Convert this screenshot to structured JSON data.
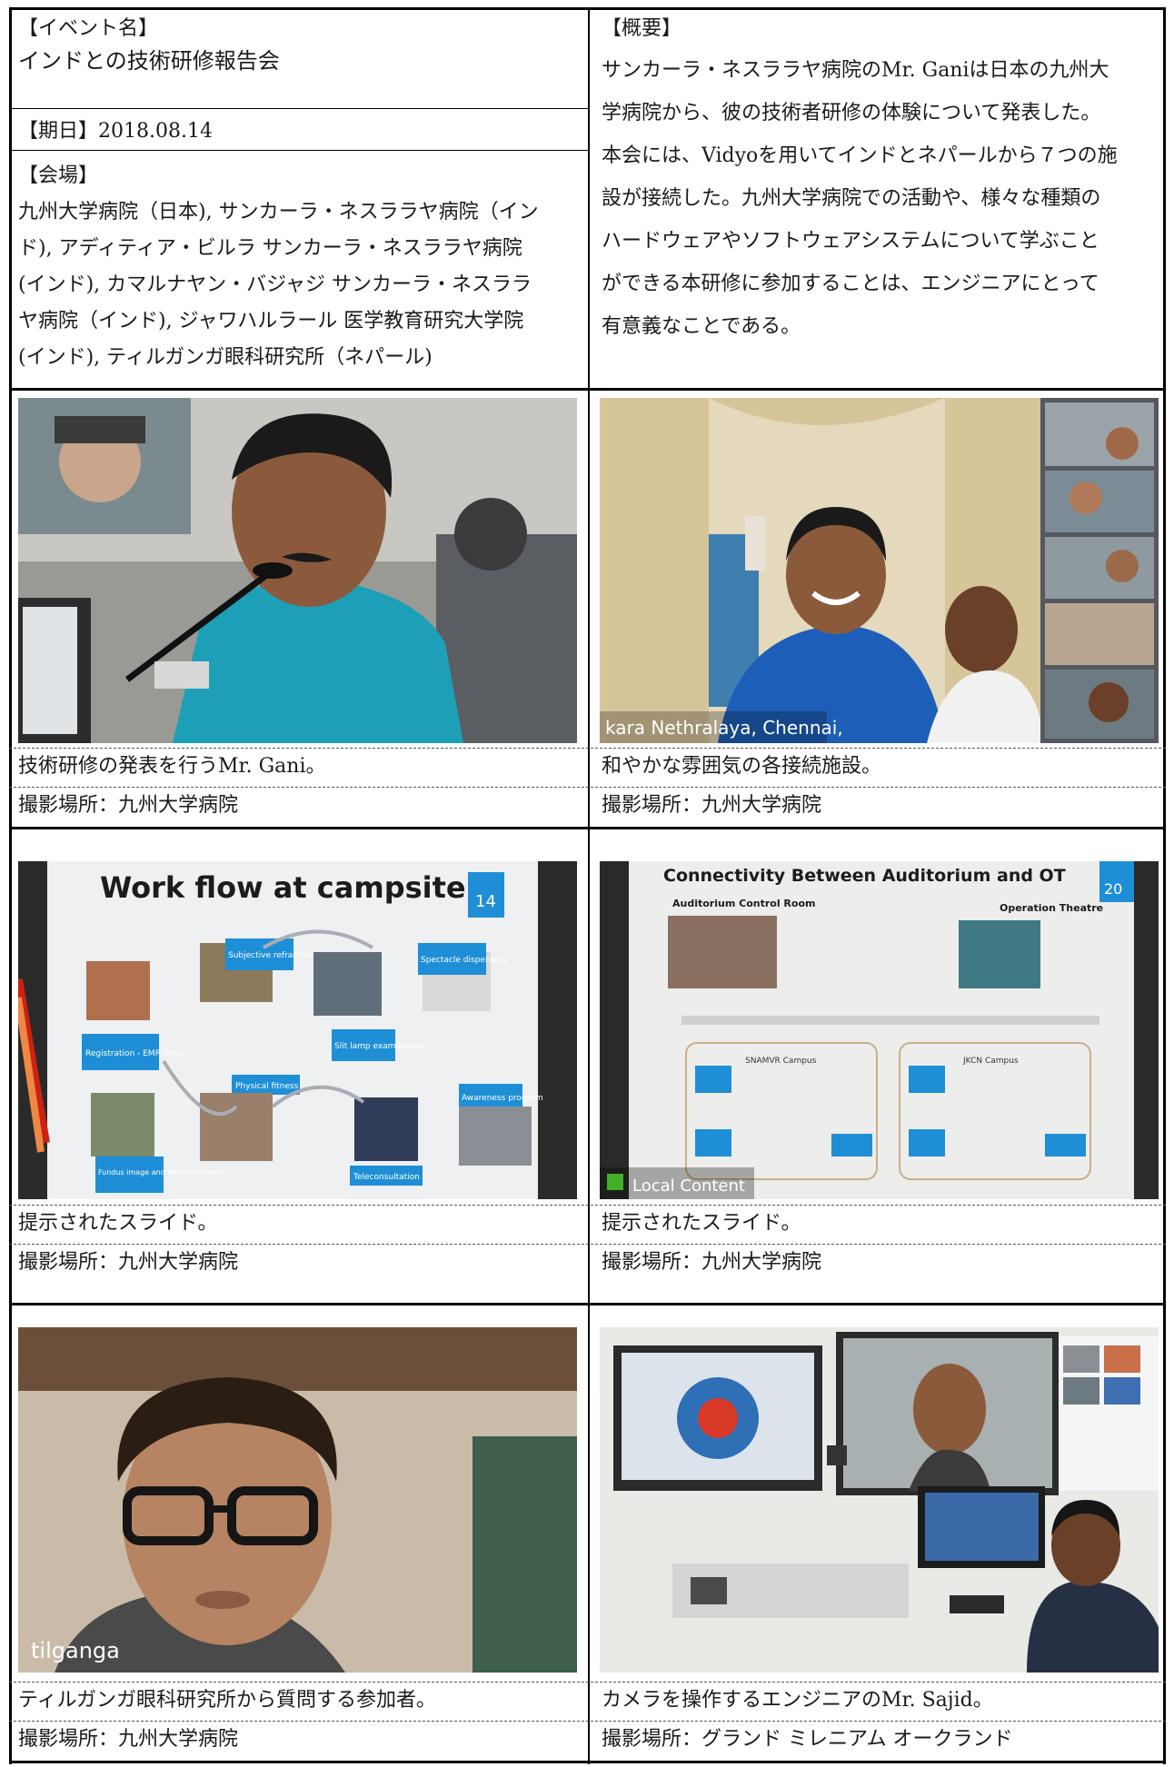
{
  "header": {
    "event_label": "【イベント名】",
    "event_name": "インドとの技術研修報告会",
    "date_line": "【期日】2018.08.14",
    "venue_label": "【会場】",
    "venue_lines": [
      "九州大学病院（日本), サンカーラ・ネスララヤ病院（イン",
      "ド), アディティア・ビルラ サンカーラ・ネスララヤ病院",
      "(インド), カマルナヤン・バジャジ サンカーラ・ネスララ",
      "ヤ病院（インド), ジャワハルラール 医学教育研究大学院",
      "(インド), ティルガンガ眼科研究所（ネパール)"
    ],
    "summary_label": "【概要】",
    "summary_lines": [
      "サンカーラ・ネスララヤ病院のMr. Ganiは日本の九州大",
      "学病院から、彼の技術者研修の体験について発表した。",
      "本会には、Vidyoを用いてインドとネパールから７つの施",
      "設が接続した。九州大学病院での活動や、様々な種類の",
      "ハードウェアやソフトウェアシステムについて学ぶこと",
      "ができる本研修に参加することは、エンジニアにとって",
      "有意義なことである。"
    ]
  },
  "photos": [
    {
      "caption": "技術研修の発表を行うMr. Gani。",
      "location": "撮影場所：九州大学病院"
    },
    {
      "caption": "和やかな雰囲気の各接続施設。",
      "location": "撮影場所：九州大学病院",
      "overlay": "kara Nethralaya, Chennai,"
    },
    {
      "caption": "提示されたスライド。",
      "location": "撮影場所：九州大学病院",
      "slide": {
        "title": "Work flow at campsite",
        "page": "14",
        "boxes": [
          "Subjective refraction",
          "Spectacle dispensing",
          "Registration - EMR Entry",
          "Slit lamp examination",
          "Physical fitness",
          "Awareness program",
          "Fundus image and teleconsultation",
          "Teleconsultation"
        ]
      }
    },
    {
      "caption": "提示されたスライド。",
      "location": "撮影場所：九州大学病院",
      "slide": {
        "title": "Connectivity Between Auditorium and OT",
        "page": "20",
        "left_heading": "Auditorium Control Room",
        "right_heading": "Operation Theatre",
        "campus_a": "SNAMVR Campus",
        "campus_b": "JKCN Campus",
        "overlay": "Local Content"
      }
    },
    {
      "caption": "ティルガンガ眼科研究所から質問する参加者。",
      "location": "撮影場所：九州大学病院",
      "overlay": "tilganga"
    },
    {
      "caption": "カメラを操作するエンジニアのMr. Sajid。",
      "location": "撮影場所：グランド ミレニアム オークランド"
    }
  ],
  "colors": {
    "rule": "#000000",
    "slide_blue": "#1e8fd6",
    "teal_shirt": "#1e9fb8",
    "saree_blue": "#1d5fb8"
  }
}
